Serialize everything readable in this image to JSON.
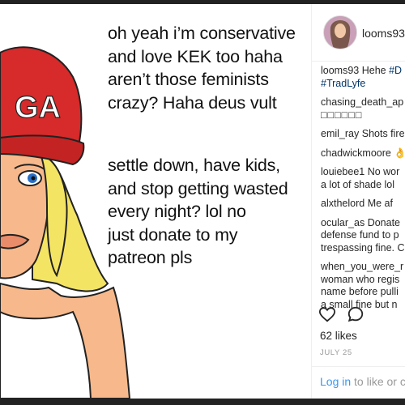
{
  "meme": {
    "hat_text": "GA",
    "paragraph1": [
      "oh yeah i’m conservative",
      "and love KEK too haha",
      "aren’t those feminists",
      "crazy? Haha deus vult"
    ],
    "paragraph2": [
      "settle down, have kids,",
      "and stop getting wasted",
      "every night? lol no",
      "just donate to my",
      "patreon pls"
    ]
  },
  "header": {
    "username": "looms93"
  },
  "caption": {
    "user": "looms93",
    "text": "Hehe",
    "hashtag1": "#D",
    "hashtag2": "#TradLyfe"
  },
  "comments": [
    {
      "user": "chasing_death_ap",
      "text": ""
    },
    {
      "user": "",
      "text": "□□□□□□"
    },
    {
      "user": "emil_ray",
      "text": "Shots fire"
    },
    {
      "user": "chadwickmoore",
      "text": "👌"
    },
    {
      "user": "louiebee1",
      "text": "No wor"
    },
    {
      "user": "",
      "text": "a lot of shade lol"
    },
    {
      "user": "alxthelord",
      "text": "Me af"
    },
    {
      "user": "ocular_as",
      "text": "Donate"
    },
    {
      "user": "",
      "text": "defense fund to p"
    },
    {
      "user": "",
      "text": "trespassing fine. C"
    },
    {
      "user": "when_you_were_r",
      "text": ""
    },
    {
      "user": "",
      "text": "woman who regis"
    },
    {
      "user": "",
      "text": "name before pulli"
    },
    {
      "user": "",
      "text": "a small fine but n"
    }
  ],
  "actions": {
    "like_icon": "heart-icon",
    "comment_icon": "comment-icon"
  },
  "stats": {
    "likes": "62 likes",
    "date": "JULY 25"
  },
  "login": {
    "link": "Log in",
    "rest": " to like or c"
  },
  "colors": {
    "hat": "#d72a2a",
    "hair": "#f4e463",
    "skin": "#f7b98b",
    "link": "#3897f0"
  }
}
